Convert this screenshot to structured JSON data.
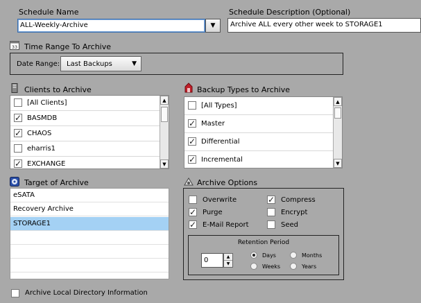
{
  "schedule_name": {
    "label": "Schedule Name",
    "value": "ALL-Weekly-Archive"
  },
  "schedule_description": {
    "label": "Schedule Description (Optional)",
    "value": "Archive ALL every other week to STORAGE1"
  },
  "time_range": {
    "title": "Time Range To Archive",
    "date_range_label": "Date Range:",
    "date_range_value": "Last Backups"
  },
  "clients": {
    "title": "Clients to Archive",
    "items": [
      {
        "label": "[All Clients]",
        "checked": false
      },
      {
        "label": "BASMDB",
        "checked": true
      },
      {
        "label": "CHAOS",
        "checked": true
      },
      {
        "label": "eharris1",
        "checked": false
      },
      {
        "label": "EXCHANGE",
        "checked": true
      }
    ]
  },
  "backup_types": {
    "title": "Backup Types to Archive",
    "items": [
      {
        "label": "[All Types]",
        "checked": false
      },
      {
        "label": "Master",
        "checked": true
      },
      {
        "label": "Differential",
        "checked": true
      },
      {
        "label": "Incremental",
        "checked": true
      }
    ]
  },
  "target": {
    "title": "Target of Archive",
    "items": [
      "eSATA",
      "Recovery Archive",
      "STORAGE1"
    ],
    "selected": "STORAGE1"
  },
  "archive_options": {
    "title": "Archive Options",
    "overwrite": {
      "label": "Overwrite",
      "checked": false
    },
    "compress": {
      "label": "Compress",
      "checked": true
    },
    "purge": {
      "label": "Purge",
      "checked": true
    },
    "encrypt": {
      "label": "Encrypt",
      "checked": false
    },
    "email_report": {
      "label": "E-Mail Report",
      "checked": true
    },
    "seed": {
      "label": "Seed",
      "checked": false
    },
    "retention": {
      "title": "Retention Period",
      "value": "0",
      "units": [
        "Days",
        "Months",
        "Weeks",
        "Years"
      ],
      "selected_unit": "Days"
    }
  },
  "archive_local_dir": {
    "label": "Archive Local Directory Information",
    "checked": false
  },
  "colors": {
    "background": "#a9a9a9",
    "selection": "#a4d1f4",
    "focus_border": "#3a6fb0"
  },
  "icons": {
    "time_range": "calendar-icon",
    "clients": "computer-icon",
    "backup_types": "backup-types-icon",
    "target": "disk-icon",
    "archive_options": "options-icon"
  }
}
